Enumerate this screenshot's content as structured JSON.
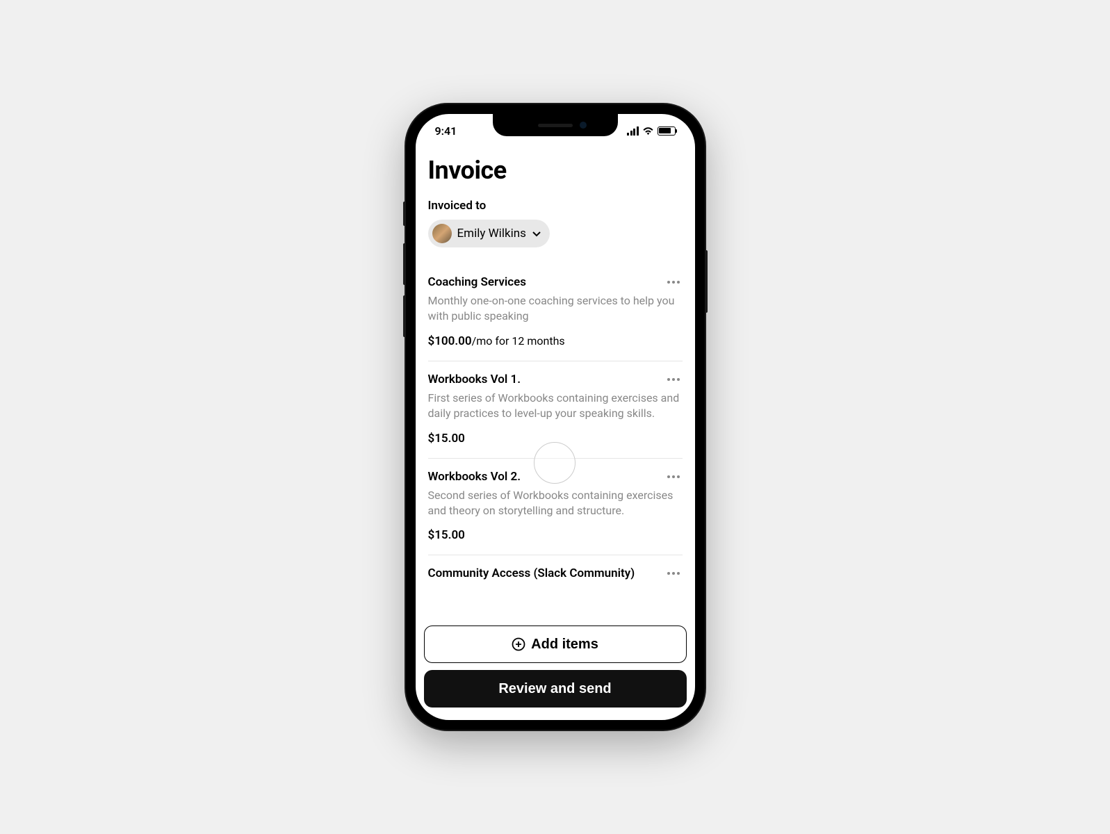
{
  "status": {
    "time": "9:41"
  },
  "page": {
    "title": "Invoice"
  },
  "invoiced_to": {
    "label": "Invoiced to",
    "name": "Emily Wilkins"
  },
  "items": [
    {
      "title": "Coaching Services",
      "desc": "Monthly one-on-one coaching services to help you with public speaking",
      "price": "$100.00",
      "suffix": "/mo for 12 months"
    },
    {
      "title": "Workbooks Vol 1.",
      "desc": "First series of Workbooks containing exercises and daily practices to level-up your speaking skills.",
      "price": "$15.00",
      "suffix": ""
    },
    {
      "title": "Workbooks Vol 2.",
      "desc": "Second series of Workbooks containing exercises and theory on storytelling and structure.",
      "price": "$15.00",
      "suffix": ""
    },
    {
      "title": "Community Access (Slack Community)",
      "desc": "",
      "price": "",
      "suffix": ""
    }
  ],
  "actions": {
    "add": "Add items",
    "review": "Review and send"
  }
}
